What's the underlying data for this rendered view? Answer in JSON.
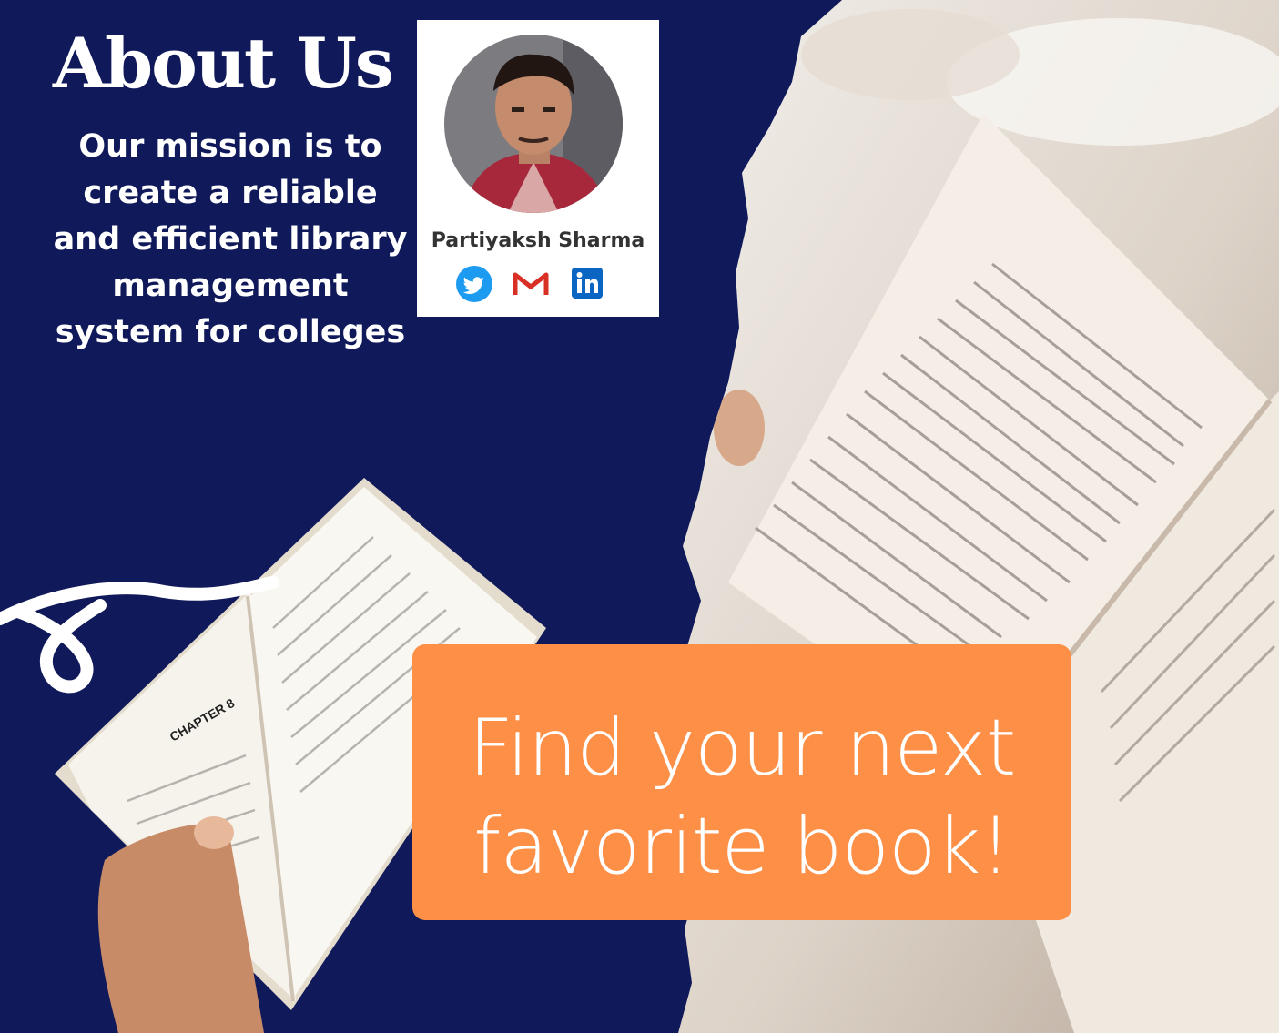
{
  "header": {
    "title": "About Us",
    "mission": "Our mission is to create a reliable and efficient library management system for colleges"
  },
  "profile": {
    "name": "Partiyaksh Sharma",
    "socials": [
      {
        "name": "twitter",
        "icon": "twitter-icon",
        "color": "#1d9bf0"
      },
      {
        "name": "gmail",
        "icon": "gmail-icon",
        "color": "#d93025"
      },
      {
        "name": "linkedin",
        "icon": "linkedin-icon",
        "color": "#0a66c2"
      }
    ]
  },
  "cta": {
    "line1": "Find your next",
    "line2": "favorite book!"
  },
  "colors": {
    "background": "#10195a",
    "cta": "#fe8f47",
    "text": "#ffffff"
  }
}
